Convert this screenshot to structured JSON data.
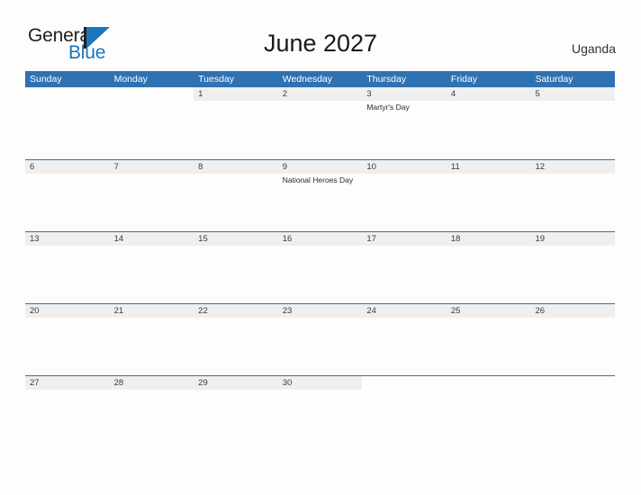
{
  "brand": {
    "name_part1": "General",
    "name_part2": "Blue",
    "logo_icon": "triangle-flag-icon"
  },
  "header": {
    "title": "June 2027",
    "country": "Uganda"
  },
  "colors": {
    "header_blue": "#2f72b3",
    "band_gray": "#efefef",
    "brand_blue": "#1b75bb",
    "text_dark": "#231f20"
  },
  "calendar": {
    "weekdays": [
      "Sunday",
      "Monday",
      "Tuesday",
      "Wednesday",
      "Thursday",
      "Friday",
      "Saturday"
    ],
    "weeks": [
      [
        {
          "date": "",
          "events": []
        },
        {
          "date": "",
          "events": []
        },
        {
          "date": "1",
          "events": []
        },
        {
          "date": "2",
          "events": []
        },
        {
          "date": "3",
          "events": [
            "Martyr's Day"
          ]
        },
        {
          "date": "4",
          "events": []
        },
        {
          "date": "5",
          "events": []
        }
      ],
      [
        {
          "date": "6",
          "events": []
        },
        {
          "date": "7",
          "events": []
        },
        {
          "date": "8",
          "events": []
        },
        {
          "date": "9",
          "events": [
            "National Heroes Day"
          ]
        },
        {
          "date": "10",
          "events": []
        },
        {
          "date": "11",
          "events": []
        },
        {
          "date": "12",
          "events": []
        }
      ],
      [
        {
          "date": "13",
          "events": []
        },
        {
          "date": "14",
          "events": []
        },
        {
          "date": "15",
          "events": []
        },
        {
          "date": "16",
          "events": []
        },
        {
          "date": "17",
          "events": []
        },
        {
          "date": "18",
          "events": []
        },
        {
          "date": "19",
          "events": []
        }
      ],
      [
        {
          "date": "20",
          "events": []
        },
        {
          "date": "21",
          "events": []
        },
        {
          "date": "22",
          "events": []
        },
        {
          "date": "23",
          "events": []
        },
        {
          "date": "24",
          "events": []
        },
        {
          "date": "25",
          "events": []
        },
        {
          "date": "26",
          "events": []
        }
      ],
      [
        {
          "date": "27",
          "events": []
        },
        {
          "date": "28",
          "events": []
        },
        {
          "date": "29",
          "events": []
        },
        {
          "date": "30",
          "events": []
        },
        {
          "date": "",
          "events": []
        },
        {
          "date": "",
          "events": []
        },
        {
          "date": "",
          "events": []
        }
      ]
    ]
  }
}
